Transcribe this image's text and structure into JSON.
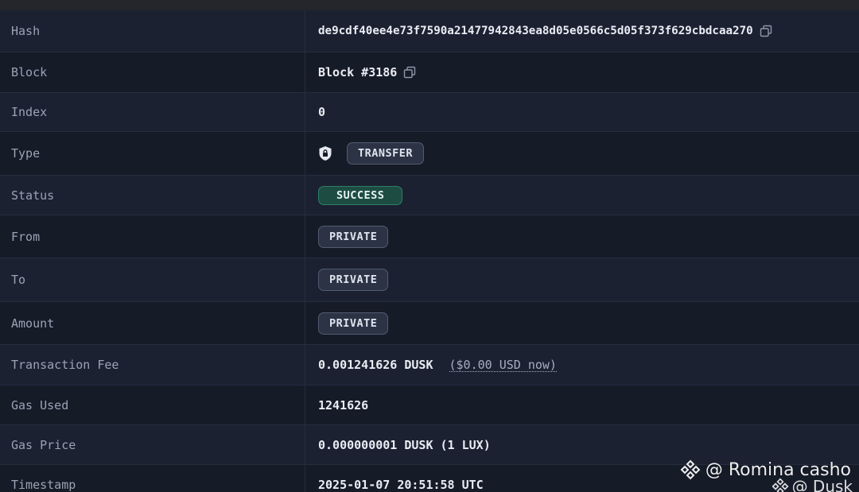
{
  "rows": [
    {
      "label": "Hash",
      "value": "de9cdf40ee4e73f7590a21477942843ea8d05e0566c5d05f373f629cbdcaa270"
    },
    {
      "label": "Block",
      "value": "Block #3186"
    },
    {
      "label": "Index",
      "value": "0"
    },
    {
      "label": "Type",
      "badge": "TRANSFER"
    },
    {
      "label": "Status",
      "badge": "SUCCESS"
    },
    {
      "label": "From",
      "badge": "PRIVATE"
    },
    {
      "label": "To",
      "badge": "PRIVATE"
    },
    {
      "label": "Amount",
      "badge": "PRIVATE"
    },
    {
      "label": "Transaction Fee",
      "value": "0.001241626 DUSK",
      "usd": "($0.00 USD now)"
    },
    {
      "label": "Gas Used",
      "value": "1241626"
    },
    {
      "label": "Gas Price",
      "value": "0.000000001 DUSK (1 LUX)"
    },
    {
      "label": "Timestamp",
      "value": "2025-01-07 20:51:58 UTC"
    }
  ],
  "watermark": {
    "line1": "@ Romina casho",
    "line2": "@ Dusk"
  },
  "colors": {
    "background": "#161b28",
    "row_alt": "#1b2131",
    "success": "#1d4c43",
    "badge": "#2b3345"
  },
  "icons": {
    "copy": "copy-icon",
    "shield": "shield-lock-icon",
    "watermark_logo": "binance-diamond-icon"
  }
}
